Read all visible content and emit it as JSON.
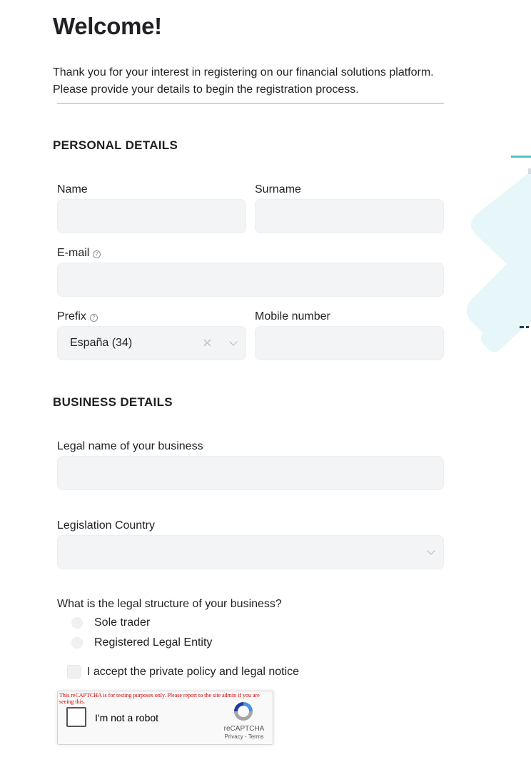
{
  "header": {
    "title": "Welcome!",
    "intro": "Thank you for your interest in registering on our financial solutions platform. Please provide your details to begin the registration process."
  },
  "personal": {
    "section_title": "PERSONAL DETAILS",
    "name_label": "Name",
    "surname_label": "Surname",
    "email_label": "E-mail",
    "prefix_label": "Prefix",
    "prefix_value": "España (34)",
    "mobile_label": "Mobile number",
    "name_value": "",
    "surname_value": "",
    "email_value": "",
    "mobile_value": ""
  },
  "business": {
    "section_title": "BUSINESS DETAILS",
    "legal_name_label": "Legal name of your business",
    "legal_name_value": "",
    "country_label": "Legislation Country",
    "country_value": "",
    "structure_question": "What is the legal structure of your business?",
    "structure_options": [
      "Sole trader",
      "Registered Legal Entity"
    ]
  },
  "consent": {
    "accept_label": "I accept the private policy and legal notice"
  },
  "recaptcha": {
    "warning": "This reCAPTCHA is for testing purposes only. Please report to the site admin if you are seeing this.",
    "label": "I'm not a robot",
    "brand": "reCAPTCHA",
    "links": "Privacy - Terms"
  },
  "icons": {
    "info": "info-circle-icon",
    "clear": "clear-x-icon",
    "chevron": "chevron-down-icon"
  },
  "colors": {
    "input_bg": "#f3f4f6",
    "accent_teal": "#4fc4c8",
    "decor_light": "#e7f6f8",
    "decor_navy": "#1f3b5c",
    "recaptcha_warning": "#d00000"
  }
}
